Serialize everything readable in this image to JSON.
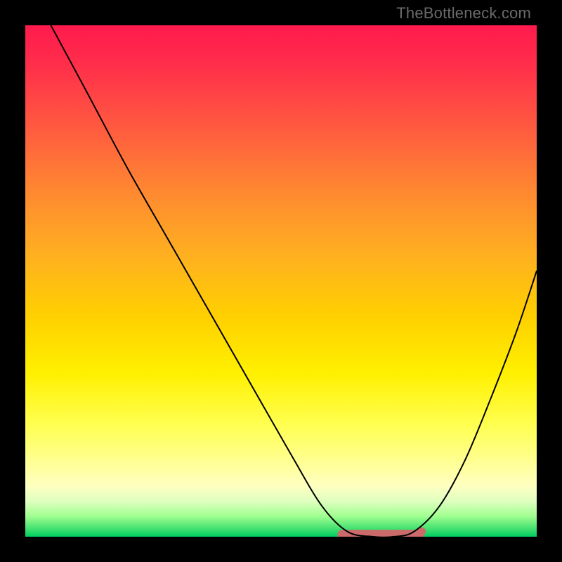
{
  "watermark": "TheBottleneck.com",
  "chart_data": {
    "type": "line",
    "title": "",
    "xlabel": "",
    "ylabel": "",
    "xlim": [
      0,
      1
    ],
    "ylim": [
      0,
      1
    ],
    "grid": false,
    "legend": false,
    "series": [
      {
        "name": "curve",
        "color": "#000000",
        "stroke_width": 2,
        "x": [
          0.05,
          0.12,
          0.2,
          0.28,
          0.36,
          0.44,
          0.52,
          0.58,
          0.63,
          0.68,
          0.72,
          0.76,
          0.81,
          0.86,
          0.91,
          0.96,
          1.0
        ],
        "y": [
          1.0,
          0.87,
          0.72,
          0.58,
          0.44,
          0.3,
          0.16,
          0.06,
          0.01,
          0.0,
          0.0,
          0.01,
          0.06,
          0.15,
          0.27,
          0.4,
          0.52
        ]
      },
      {
        "name": "floor-band",
        "type": "band",
        "color": "#cc6b6b",
        "stroke_width": 14,
        "x": [
          0.62,
          0.77
        ],
        "y": [
          0.004,
          0.004
        ]
      }
    ],
    "annotations": [
      {
        "type": "dot",
        "x": 0.775,
        "y": 0.01,
        "r": 6,
        "color": "#cc6b6b"
      }
    ]
  },
  "colors": {
    "curve": "#000000",
    "band": "#cc6b6b",
    "dot": "#cc6b6b",
    "frame_bg": "#000000"
  }
}
